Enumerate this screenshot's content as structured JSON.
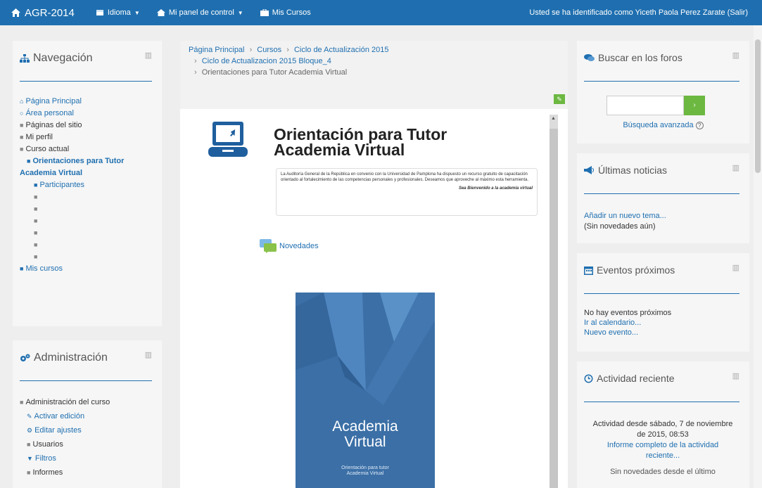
{
  "topbar": {
    "site_name": "AGR-2014",
    "language": "Idioma",
    "dashboard": "Mi panel de control",
    "my_courses": "Mis Cursos",
    "user_text": "Usted se ha identificado como Yiceth Paola Perez Zarate (Salir)",
    "brand_color": "#1f6fb0"
  },
  "navigation": {
    "title": "Navegación",
    "items": [
      {
        "label": "Página Principal",
        "indent": 0,
        "style": "link"
      },
      {
        "label": "Área personal",
        "indent": 0,
        "style": "link"
      },
      {
        "label": "Páginas del sitio",
        "indent": 0,
        "style": "text"
      },
      {
        "label": "Mi perfil",
        "indent": 0,
        "style": "text"
      },
      {
        "label": "Curso actual",
        "indent": 0,
        "style": "text"
      },
      {
        "label": "Orientaciones para Tutor",
        "indent": 1,
        "style": "active"
      },
      {
        "label": "Academia Virtual",
        "indent": 0,
        "style": "active"
      },
      {
        "label": "Participantes",
        "indent": 2,
        "style": "link"
      },
      {
        "label": "",
        "indent": 2,
        "style": "text"
      },
      {
        "label": "",
        "indent": 2,
        "style": "text"
      },
      {
        "label": "",
        "indent": 2,
        "style": "text"
      },
      {
        "label": "",
        "indent": 2,
        "style": "text"
      },
      {
        "label": "",
        "indent": 2,
        "style": "text"
      },
      {
        "label": "",
        "indent": 2,
        "style": "text"
      },
      {
        "label": "Mis cursos",
        "indent": 0,
        "style": "link"
      }
    ]
  },
  "administration": {
    "title": "Administración",
    "items": [
      {
        "label": "Administración del curso",
        "indent": 0,
        "icon": "folder-icon",
        "style": "text"
      },
      {
        "label": "Activar edición",
        "indent": 1,
        "icon": "pencil-icon",
        "style": "link"
      },
      {
        "label": "Editar ajustes",
        "indent": 1,
        "icon": "gear-icon",
        "style": "link"
      },
      {
        "label": "Usuarios",
        "indent": 1,
        "icon": "folder-icon",
        "style": "text"
      },
      {
        "label": "Filtros",
        "indent": 1,
        "icon": "filter-icon",
        "style": "link"
      },
      {
        "label": "Informes",
        "indent": 1,
        "icon": "folder-icon",
        "style": "text"
      }
    ]
  },
  "breadcrumb": {
    "line1": [
      "Página Principal",
      "Cursos",
      "Ciclo de Actualización 2015"
    ],
    "line2": "Ciclo de Actualizacion 2015 Bloque_4",
    "line3": "Orientaciones para Tutor Academia Virtual"
  },
  "content": {
    "hero_title_line1": "Orientación para Tutor",
    "hero_title_line2": "Academia Virtual",
    "intro_text": "La Auditoría General de la República en convenio con la Universidad de Pamplona ha dispuesto un recurso gratuito de capacitación orientado al fortalecimiento de las competencias personales y profesionales. Deseamos que aproveche al máximo esta herramienta.",
    "welcome_text": "Sea Bienvenido a la academia virtual",
    "forum_link": "Novedades",
    "cover_title_line1": "Academia",
    "cover_title_line2": "Virtual",
    "cover_sub_line1": "Orientación para tutor",
    "cover_sub_line2": "Academia Virtual"
  },
  "search_forums": {
    "title": "Buscar en los foros",
    "input_value": "",
    "button_label": "›",
    "advanced_link": "Búsqueda avanzada"
  },
  "latest_news": {
    "title": "Últimas noticias",
    "add_topic": "Añadir un nuevo tema...",
    "no_news": "(Sin novedades aún)"
  },
  "upcoming_events": {
    "title": "Eventos próximos",
    "no_events": "No hay eventos próximos",
    "calendar_link": "Ir al calendario...",
    "new_event_link": "Nuevo evento..."
  },
  "recent_activity": {
    "title": "Actividad reciente",
    "since_text": "Actividad desde sábado, 7 de noviembre de 2015, 08:53",
    "report_link": "Informe completo de la actividad reciente...",
    "no_news_partial": "Sin novedades desde el último"
  },
  "colors": {
    "accent_green": "#6cb841",
    "link_blue": "#1f6fb0"
  }
}
